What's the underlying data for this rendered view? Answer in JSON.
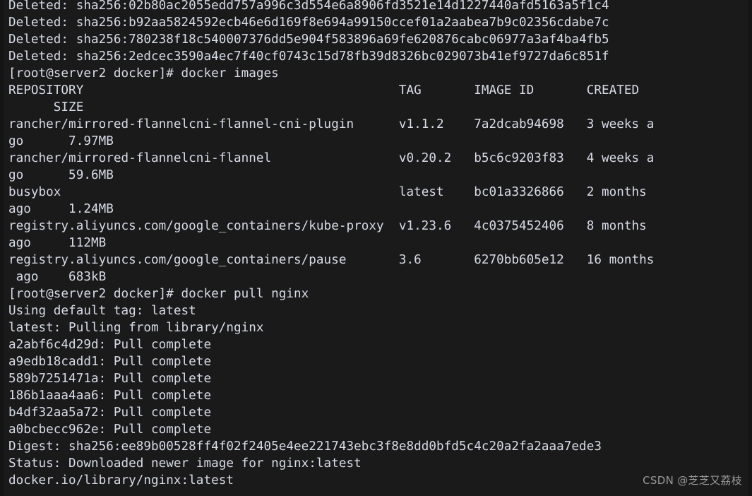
{
  "terminal": {
    "background_color": "#1a1a1a",
    "foreground_color": "#d8dce8",
    "columns": 89,
    "rows": 29,
    "lines": [
      "Deleted: sha256:02b80ac2055edd757a996c3d554e6a8906fd3521e14d1227440afd5163a5f1c4",
      "Deleted: sha256:b92aa5824592ecb46e6d169f8e694a99150ccef01a2aabea7b9c02356cdabe7c",
      "Deleted: sha256:780238f18c540007376dd5e904f583896a69fe620876cabc06977a3af4ba4fb5",
      "Deleted: sha256:2edcec3590a4ec7f40cf0743c15d78fb39d8326bc029073b41ef9727da6c851f",
      "[root@server2 docker]# docker images",
      "REPOSITORY                                          TAG       IMAGE ID       CREATED",
      "      SIZE",
      "rancher/mirrored-flannelcni-flannel-cni-plugin      v1.1.2    7a2dcab94698   3 weeks a",
      "go      7.97MB",
      "rancher/mirrored-flannelcni-flannel                 v0.20.2   b5c6c9203f83   4 weeks a",
      "go      59.6MB",
      "busybox                                             latest    bc01a3326866   2 months",
      "ago     1.24MB",
      "registry.aliyuncs.com/google_containers/kube-proxy  v1.23.6   4c0375452406   8 months",
      "ago     112MB",
      "registry.aliyuncs.com/google_containers/pause       3.6       6270bb605e12   16 months",
      " ago    683kB",
      "[root@server2 docker]# docker pull nginx",
      "Using default tag: latest",
      "latest: Pulling from library/nginx",
      "a2abf6c4d29d: Pull complete",
      "a9edb18cadd1: Pull complete",
      "589b7251471a: Pull complete",
      "186b1aaa4aa6: Pull complete",
      "b4df32aa5a72: Pull complete",
      "a0bcbecc962e: Pull complete",
      "Digest: sha256:ee89b00528ff4f02f2405e4ee221743ebc3f8e8dd0bfd5c4c20a2fa2aaa7ede3",
      "Status: Downloaded newer image for nginx:latest",
      "docker.io/library/nginx:latest"
    ]
  },
  "watermark": {
    "text": "CSDN @芝芝又荔枝",
    "color": "#9a9a9a"
  }
}
